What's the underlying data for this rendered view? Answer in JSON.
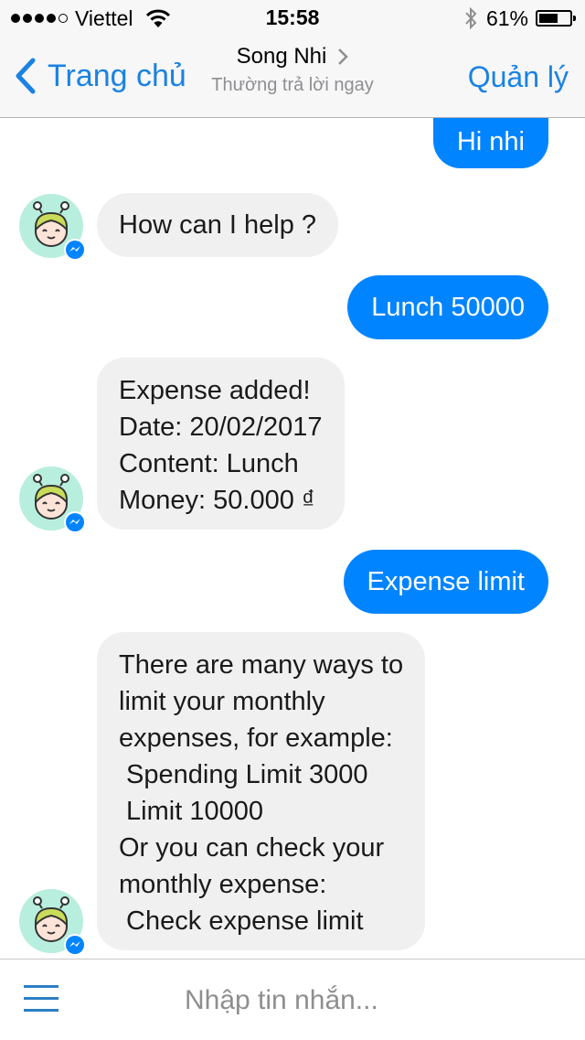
{
  "status_bar": {
    "signal_bars_filled": 4,
    "signal_bars_total": 5,
    "carrier": "Viettel",
    "time": "15:58",
    "battery_percent_label": "61%",
    "battery_level": 0.61,
    "icons": [
      "wifi-icon",
      "bluetooth-icon",
      "battery-icon"
    ]
  },
  "nav": {
    "back_label": "Trang chủ",
    "title": "Song Nhi",
    "subtitle": "Thường trả lời ngay",
    "right_label": "Quản lý",
    "accent_color": "#1a82e2"
  },
  "chat": {
    "outgoing_color": "#0084ff",
    "incoming_color": "#f1f0f0",
    "messages": [
      {
        "from": "user",
        "text": "Hi nhi"
      },
      {
        "from": "bot",
        "text": "How can I help ?"
      },
      {
        "from": "user",
        "text": "Lunch 50000"
      },
      {
        "from": "bot",
        "text": "Expense added!\nDate: 20/02/2017\nContent: Lunch\nMoney: 50.000 ₫"
      },
      {
        "from": "user",
        "text": "Expense limit"
      },
      {
        "from": "bot",
        "text": "There are many ways to\nlimit your monthly\nexpenses, for example:\n Spending Limit 3000\n Limit 10000\nOr you can check your\nmonthly expense:\n Check expense limit"
      }
    ]
  },
  "composer": {
    "placeholder": "Nhập tin nhắn...",
    "value": "",
    "menu_icon": "hamburger-menu-icon"
  }
}
